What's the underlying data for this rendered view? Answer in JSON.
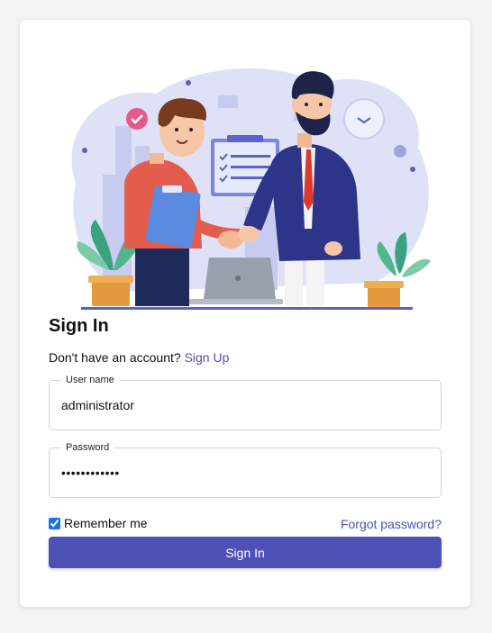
{
  "form": {
    "title": "Sign In",
    "no_account_text": "Don't have an account?",
    "signup_link": "Sign Up",
    "username_label": "User name",
    "username_value": "administrator",
    "password_label": "Password",
    "password_value": "••••••••••••",
    "remember_label": "Remember me",
    "remember_checked": true,
    "forgot_link": "Forgot password?",
    "submit_label": "Sign In"
  },
  "colors": {
    "accent": "#4f50b5",
    "link": "#4b52b3",
    "background": "#f3f3f3"
  },
  "illustration": {
    "icon": "handshake-illustration"
  }
}
